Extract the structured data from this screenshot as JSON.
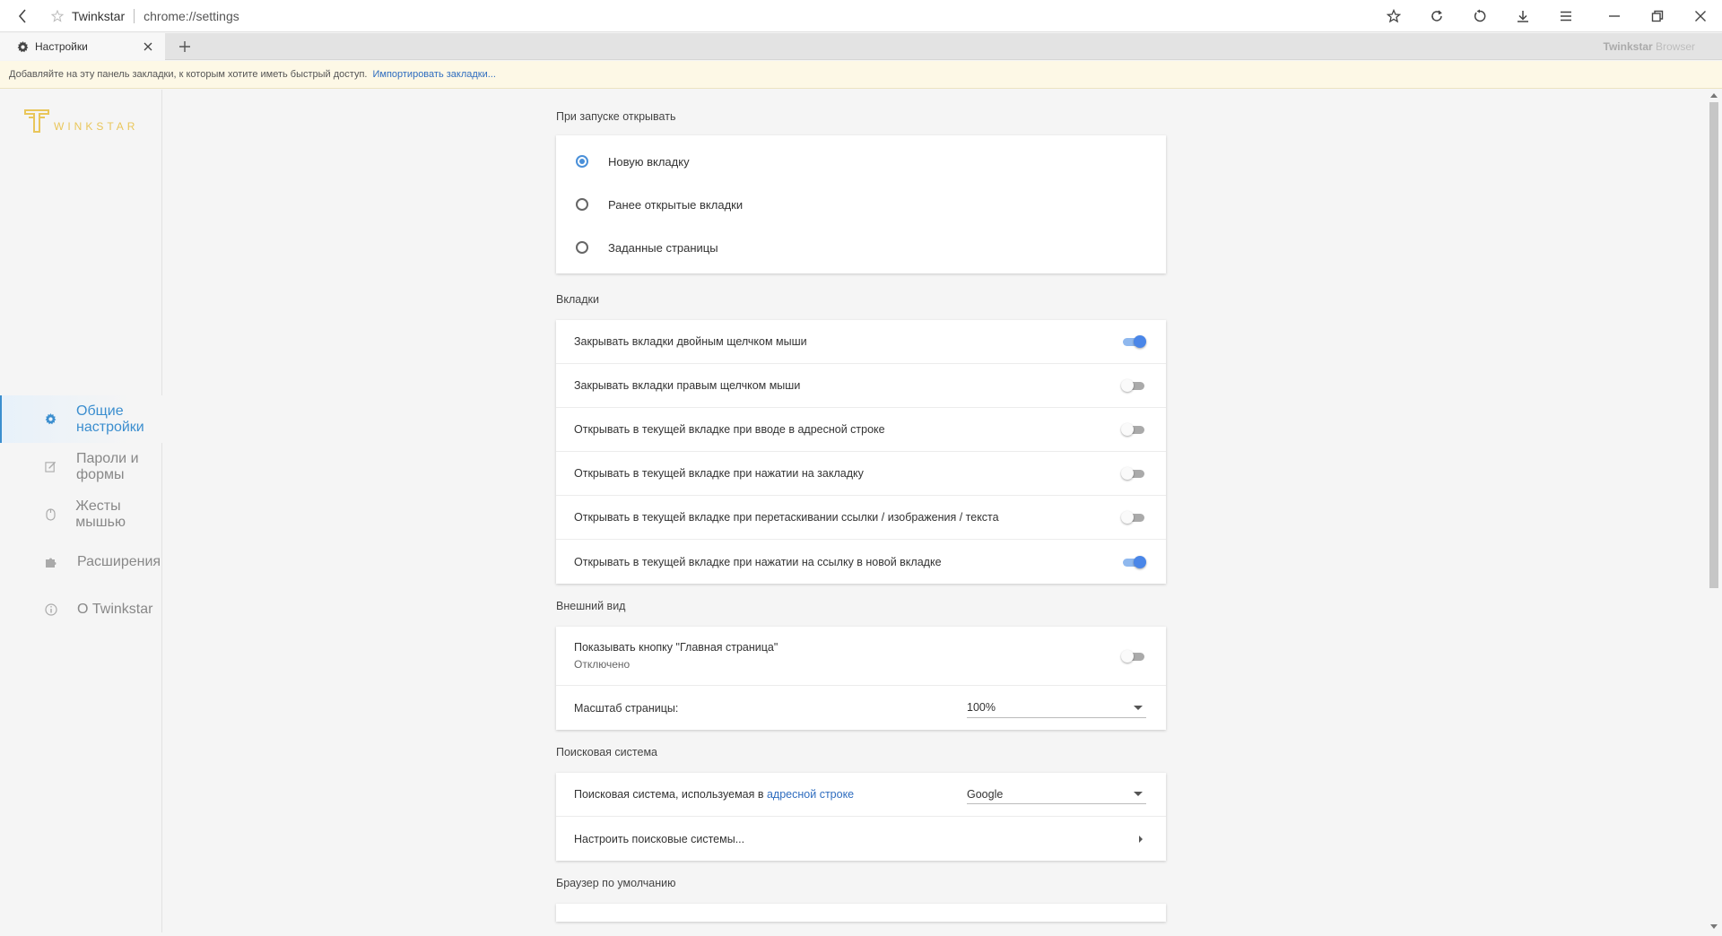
{
  "titlebar": {
    "site_name": "Twinkstar",
    "url": "chrome://settings"
  },
  "tab": {
    "label": "Настройки"
  },
  "brand": {
    "bold": "Twinkstar",
    "rest": " Browser"
  },
  "bookmarks_bar": {
    "text": "Добавляйте на эту панель закладки, к которым хотите иметь быстрый доступ.",
    "link": "Импортировать закладки..."
  },
  "logo": {
    "text": "WINKSTAR",
    "color": "#e9c65a"
  },
  "sidebar": {
    "items": [
      {
        "label": "Общие настройки",
        "icon": "gear-icon",
        "active": true
      },
      {
        "label": "Пароли и формы",
        "icon": "edit-icon",
        "active": false
      },
      {
        "label": "Жесты мышью",
        "icon": "mouse-icon",
        "active": false
      },
      {
        "label": "Расширения",
        "icon": "puzzle-icon",
        "active": false
      },
      {
        "label": "О Twinkstar",
        "icon": "info-icon",
        "active": false
      }
    ]
  },
  "startup": {
    "title": "При запуске открывать",
    "options": [
      {
        "label": "Новую вкладку",
        "selected": true
      },
      {
        "label": "Ранее открытые вкладки",
        "selected": false
      },
      {
        "label": "Заданные страницы",
        "selected": false
      }
    ]
  },
  "tabs_section": {
    "title": "Вкладки",
    "items": [
      {
        "label": "Закрывать вкладки двойным щелчком мыши",
        "on": true
      },
      {
        "label": "Закрывать вкладки правым щелчком мыши",
        "on": false
      },
      {
        "label": "Открывать в текущей вкладке при вводе в адресной строке",
        "on": false
      },
      {
        "label": "Открывать в текущей вкладке при нажатии на закладку",
        "on": false
      },
      {
        "label": "Открывать в текущей вкладке при перетаскивании ссылки / изображения / текста",
        "on": false
      },
      {
        "label": "Открывать в текущей вкладке при нажатии на ссылку в новой вкладке",
        "on": true
      }
    ]
  },
  "appearance": {
    "title": "Внешний вид",
    "home_button_label": "Показывать кнопку \"Главная страница\"",
    "home_button_status": "Отключено",
    "home_button_on": false,
    "zoom_label": "Масштаб страницы:",
    "zoom_value": "100%"
  },
  "search": {
    "title": "Поисковая система",
    "engine_label_prefix": "Поисковая система, используемая в ",
    "engine_label_link": "адресной строке",
    "engine_value": "Google",
    "manage_label": "Настроить поисковые системы..."
  },
  "default_browser": {
    "title": "Браузер по умолчанию"
  },
  "colors": {
    "accent": "#3b8ecf",
    "toggle_on": "#4a86e8",
    "link": "#2f6dbf"
  }
}
